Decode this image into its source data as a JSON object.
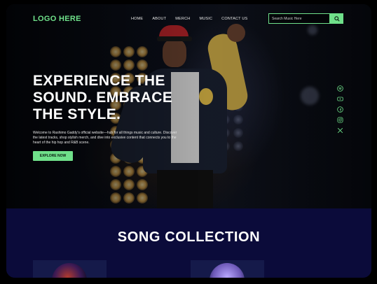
{
  "nav": {
    "logo": "LOGO HERE",
    "links": [
      {
        "label": "HOME"
      },
      {
        "label": "ABOUT"
      },
      {
        "label": "MERCH"
      },
      {
        "label": "MUSIC"
      },
      {
        "label": "CONTACT US"
      }
    ],
    "search": {
      "placeholder": "Search Music Here"
    }
  },
  "hero": {
    "headline": "EXPERIENCE THE SOUND. EMBRACE THE STYLE.",
    "intro": "Welcome to Rashimo Gaddy's official website—hub for all things music and culture. Discover the latest tracks, shop stylish merch, and dive into exclusive content that connects you to the heart of the hip hop and R&B scene.",
    "cta_label": "EXPLORE NOW"
  },
  "social": [
    "spotify-icon",
    "youtube-icon",
    "facebook-icon",
    "instagram-icon",
    "x-icon"
  ],
  "songs": {
    "title": "SONG COLLECTION"
  },
  "colors": {
    "accent": "#6fe08a",
    "section_bg": "#0b0b3a"
  }
}
